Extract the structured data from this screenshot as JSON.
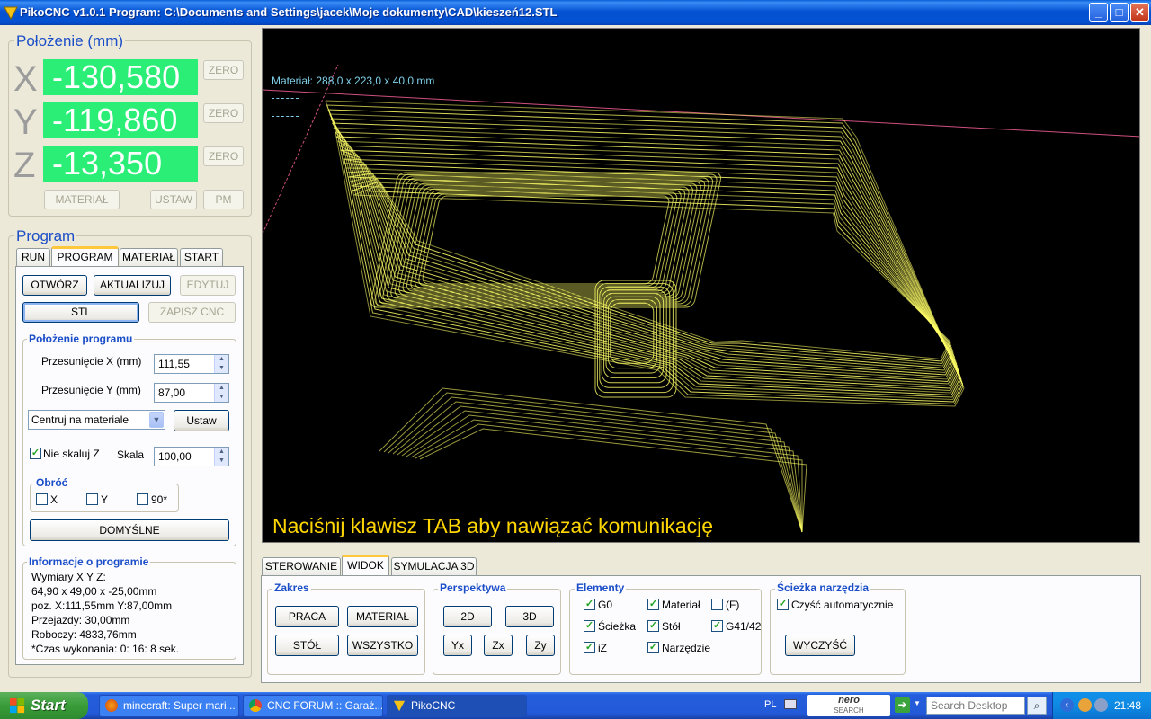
{
  "window": {
    "title": "PikoCNC v1.0.1    Program: C:\\Documents and Settings\\jacek\\Moje dokumenty\\CAD\\kieszeń12.STL"
  },
  "position": {
    "title": "Położenie (mm)",
    "axes": [
      {
        "letter": "X",
        "value": "-130,580",
        "zero_label": "ZERO"
      },
      {
        "letter": "Y",
        "value": "-119,860",
        "zero_label": "ZERO"
      },
      {
        "letter": "Z",
        "value": "-13,350",
        "zero_label": "ZERO"
      }
    ],
    "material_btn": "MATERIAŁ",
    "set_btn": "USTAW",
    "pm_btn": "PM"
  },
  "program": {
    "title": "Program",
    "tabs": [
      "RUN",
      "PROGRAM",
      "MATERIAŁ",
      "START"
    ],
    "open_btn": "OTWÓRZ",
    "update_btn": "AKTUALIZUJ",
    "edit_btn": "EDYTUJ",
    "stl_btn": "STL",
    "save_cnc_btn": "ZAPISZ CNC",
    "placement": {
      "title": "Położenie programu",
      "offset_x_label": "Przesunięcie X (mm)",
      "offset_x_value": "111,55",
      "offset_y_label": "Przesunięcie Y (mm)",
      "offset_y_value": "87,00",
      "center_option": "Centruj na materiale",
      "set_btn": "Ustaw",
      "no_scale_z_label": "Nie skaluj Z",
      "scale_label": "Skala",
      "scale_value": "100,00",
      "rotate_title": "Obróć",
      "rotate_x": "X",
      "rotate_y": "Y",
      "rotate_90": "90*",
      "default_btn": "DOMYŚLNE"
    },
    "info": {
      "title": "Informacje o programie",
      "lines": [
        "Wymiary X Y Z:",
        "64,90 x 49,00 x -25,00mm",
        "poz. X:111,55mm Y:87,00mm",
        "Przejazdy: 30,00mm",
        "Roboczy: 4833,76mm",
        "*Czas wykonania: 0: 16: 8 sek."
      ]
    }
  },
  "viewport": {
    "material_info": "Materiał: 288,0 x 223,0 x 40,0 mm",
    "comm_message": "Naciśnij klawisz TAB aby nawiązać komunikację"
  },
  "bottom": {
    "tabs": [
      "STEROWANIE",
      "WIDOK",
      "SYMULACJA 3D"
    ],
    "zakres": {
      "title": "Zakres",
      "buttons": [
        "PRACA",
        "MATERIAŁ",
        "STÓŁ",
        "WSZYSTKO"
      ]
    },
    "perspektywa": {
      "title": "Perspektywa",
      "buttons": [
        "2D",
        "3D",
        "Yx",
        "Zx",
        "Zy"
      ]
    },
    "elementy": {
      "title": "Elementy",
      "items": [
        {
          "label": "G0",
          "checked": true
        },
        {
          "label": "Materiał",
          "checked": true
        },
        {
          "label": "(F)",
          "checked": false
        },
        {
          "label": "Ścieżka",
          "checked": true
        },
        {
          "label": "Stół",
          "checked": true
        },
        {
          "label": "G41/42",
          "checked": true
        },
        {
          "label": "iZ",
          "checked": true
        },
        {
          "label": "Narzędzie",
          "checked": true
        }
      ]
    },
    "sciezka": {
      "title": "Ścieżka narzędzia",
      "auto_clear": "Czyść automatycznie",
      "clear_btn": "WYCZYŚĆ"
    }
  },
  "taskbar": {
    "start": "Start",
    "tasks": [
      "minecraft: Super mari...",
      "CNC FORUM :: Garaż...",
      "PikoCNC"
    ],
    "lang": "PL",
    "search_placeholder": "Search Desktop",
    "clock": "21:48",
    "nero_label": "nero",
    "nero_sub": "SEARCH"
  },
  "colors": {
    "dro_bg": "#2BEE77",
    "path": "#FFFF66",
    "message": "#FFD700",
    "info_cyan": "#7FD0E8",
    "group_title": "#1A4DC8"
  }
}
